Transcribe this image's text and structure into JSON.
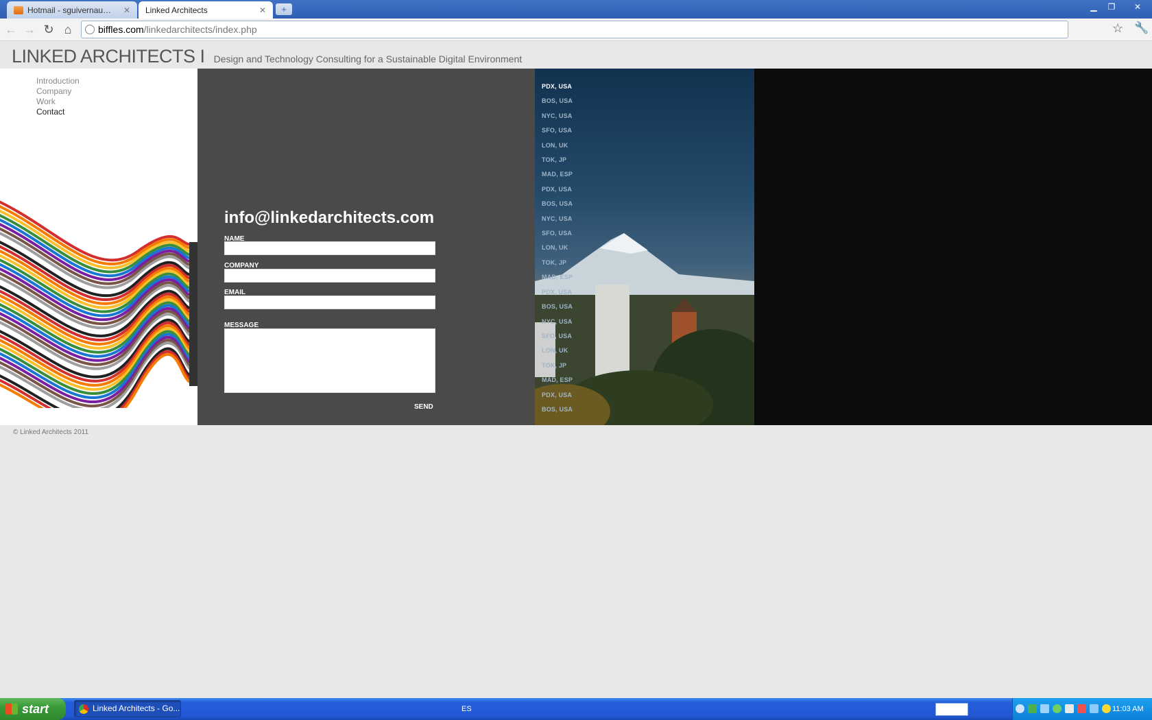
{
  "browser": {
    "tabs": [
      {
        "label": "Hotmail - sguivernau@hot...",
        "active": false
      },
      {
        "label": "Linked Architects",
        "active": true
      }
    ],
    "url_host": "biffles.com",
    "url_path": "/linkedarchitects/index.php"
  },
  "site": {
    "title": "LINKED ARCHITECTS I",
    "tagline": "Design and Technology Consulting for a Sustainable Digital Environment",
    "nav": [
      "Introduction",
      "Company",
      "Work",
      "Contact"
    ],
    "current_nav": "Contact",
    "contact_email": "info@linkedarchitects.com",
    "form": {
      "name_label": "NAME",
      "company_label": "COMPANY",
      "email_label": "EMAIL",
      "message_label": "MESSAGE",
      "send_label": "SEND"
    },
    "cities": [
      "PDX, USA",
      "BOS, USA",
      "NYC, USA",
      "SFO, USA",
      "LON, UK",
      "TOK, JP",
      "MAD, ESP",
      "PDX, USA",
      "BOS, USA",
      "NYC, USA",
      "SFO, USA",
      "LON, UK",
      "TOK, JP",
      "MAD, ESP",
      "PDX, USA",
      "BOS, USA",
      "NYC, USA",
      "SFO, USA",
      "LON, UK",
      "TOK, JP",
      "MAD, ESP",
      "PDX, USA",
      "BOS, USA"
    ],
    "selected_city_index": 0,
    "copyright": "© Linked Architects 2011"
  },
  "taskbar": {
    "start_label": "start",
    "task_label": "Linked Architects - Go...",
    "language": "ES",
    "clock": "11:03 AM"
  }
}
